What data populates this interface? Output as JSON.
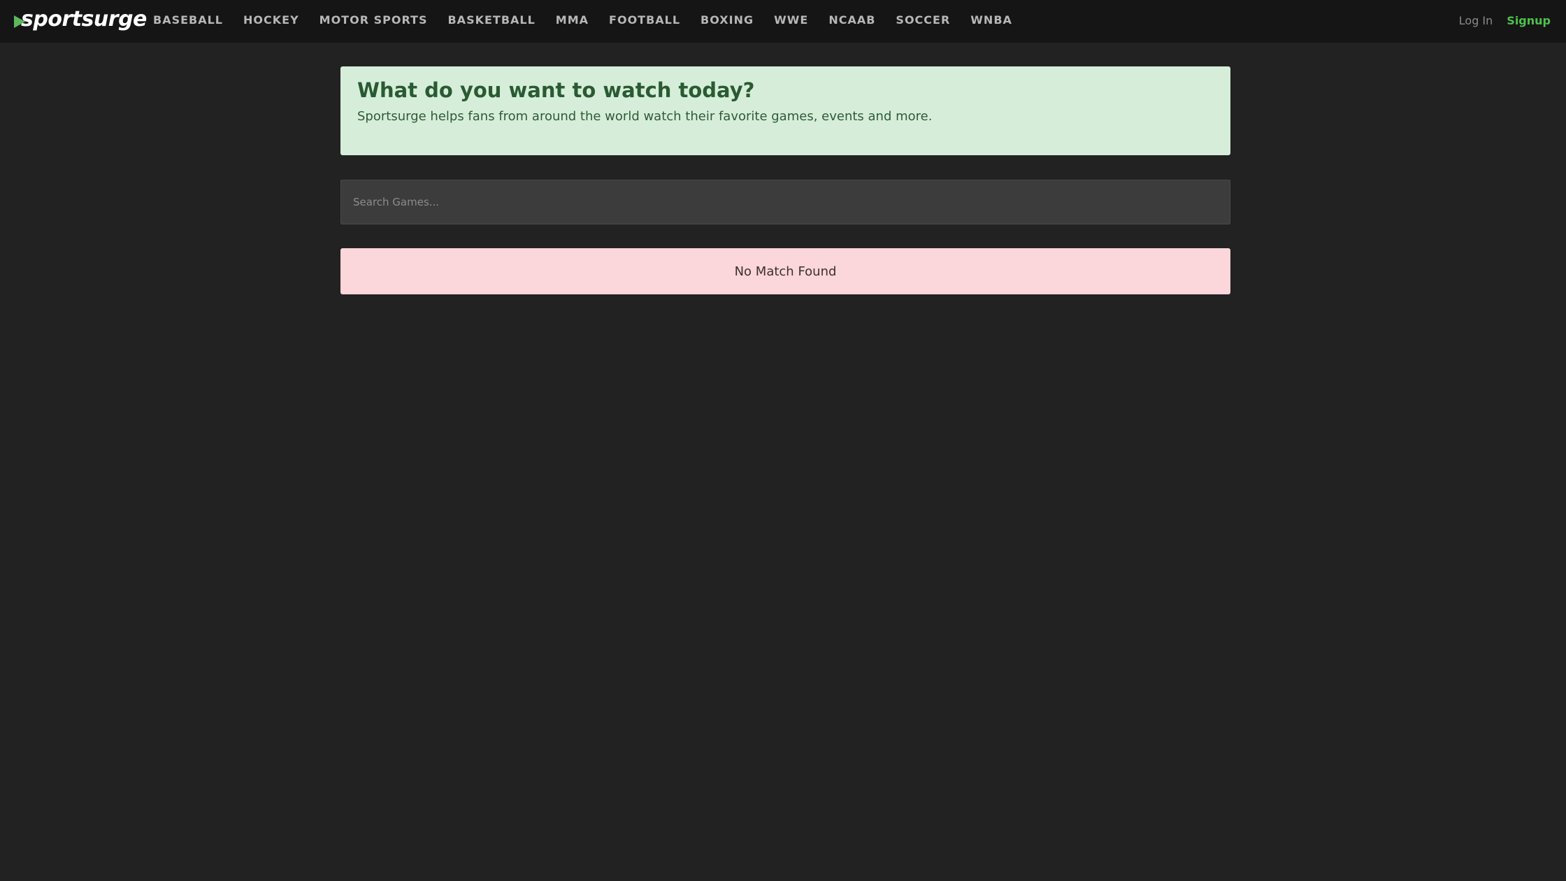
{
  "brand": {
    "name": "sportsurge",
    "icon": "play-icon",
    "accent": "#5cb85c"
  },
  "nav": {
    "items": [
      {
        "label": "BASEBALL"
      },
      {
        "label": "HOCKEY"
      },
      {
        "label": "MOTOR SPORTS"
      },
      {
        "label": "BASKETBALL"
      },
      {
        "label": "MMA"
      },
      {
        "label": "FOOTBALL"
      },
      {
        "label": "BOXING"
      },
      {
        "label": "WWE"
      },
      {
        "label": "NCAAB"
      },
      {
        "label": "SOCCER"
      },
      {
        "label": "WNBA"
      }
    ],
    "login_label": "Log In",
    "signup_label": "Signup"
  },
  "hero": {
    "title": "What do you want to watch today?",
    "subtitle": "Sportsurge helps fans from around the world watch their favorite games, events and more."
  },
  "search": {
    "placeholder": "Search Games...",
    "value": ""
  },
  "results": {
    "empty_message": "No Match Found"
  },
  "colors": {
    "background": "#222222",
    "navbar": "#151515",
    "hero_bg": "#d6eed9",
    "hero_text": "#2a5a33",
    "search_bg": "#3c3c3c",
    "empty_bg": "#fbd6da",
    "signup": "#4cc24c"
  }
}
